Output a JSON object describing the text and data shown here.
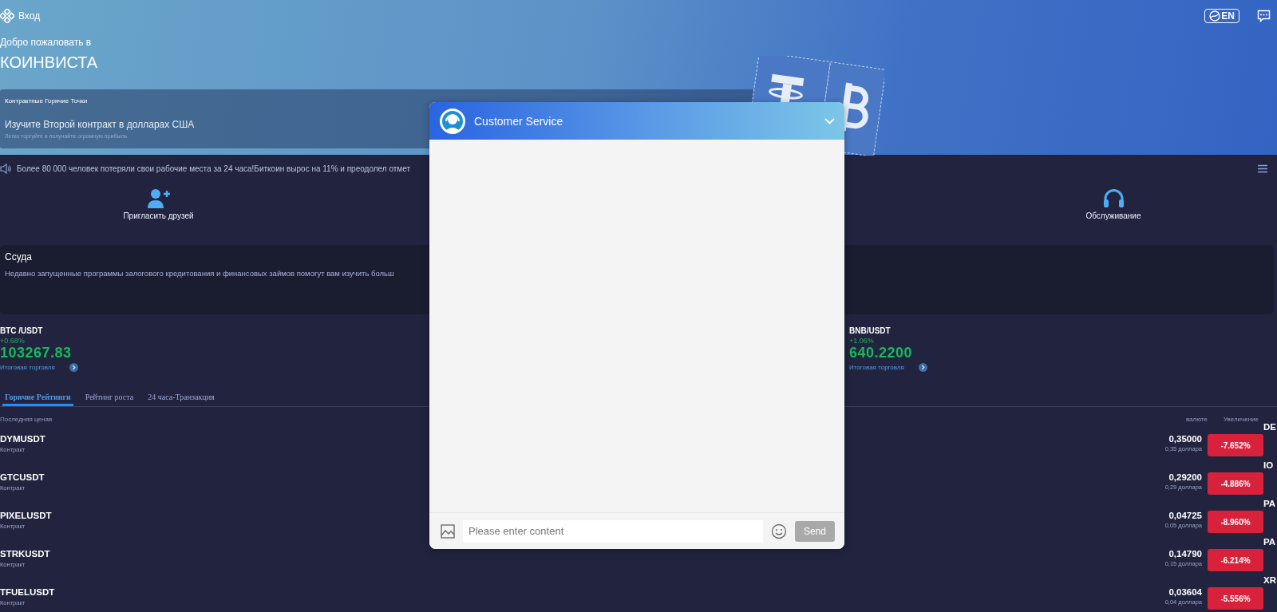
{
  "header": {
    "login": "Вход",
    "language": "EN",
    "welcome": "Добро пожаловать в",
    "brand": "КОИНВИСТА"
  },
  "banner": {
    "label": "Контрактные Горячие Точки",
    "title": "Изучите Второй контракт в долларах США",
    "subtitle": "Легко торгуйте и получайте огромную прибыль"
  },
  "ticker": {
    "text": "Более 80 000 человек потеряли свои рабочие места за 24 часа!Биткоин вырос на 11% и преодолел отмет"
  },
  "quick_actions": [
    {
      "kind": "invite",
      "label": "Пригласить друзей"
    },
    {
      "kind": "service",
      "label": "Обслуживание"
    }
  ],
  "loan": {
    "title": "Ссуда",
    "text": "Недавно запущенные программы залогового кредитования и финансовых займов помогут вам изучить больш"
  },
  "markets": [
    {
      "pair": "BTC /USDT",
      "change": "+0.68%",
      "price": "103267.83",
      "link": "Итоговая торговля"
    },
    {
      "pair": "BNB/USDT",
      "change": "+1.06%",
      "price": "640.2200",
      "link": "Итоговая торговля"
    }
  ],
  "tabs": [
    {
      "label": "Горячие Рейтинги",
      "selected": true
    },
    {
      "label": "Рейтинг роста",
      "selected": false
    },
    {
      "label": "24 часа-Транзакция",
      "selected": false
    }
  ],
  "table": {
    "columns": [
      "Последняя ценав",
      "валюте",
      "Увеличение"
    ],
    "rows": [
      {
        "symbol": "DYMUSDT",
        "type": "Контракт",
        "price": "0,35000",
        "usd": "0,35 доллара",
        "change": "-7.652%",
        "adjacent_symbol": "DE"
      },
      {
        "symbol": "GTCUSDT",
        "type": "Контракт",
        "price": "0,29200",
        "usd": "0,29 доллара",
        "change": "-4.886%",
        "adjacent_symbol": "IO"
      },
      {
        "symbol": "PIXELUSDT",
        "type": "Контракт",
        "price": "0,04725",
        "usd": "0,05 доллара",
        "change": "-8.960%",
        "adjacent_symbol": "PA"
      },
      {
        "symbol": "STRKUSDT",
        "type": "Контракт",
        "price": "0,14790",
        "usd": "0,15 доллара",
        "change": "-6.214%",
        "adjacent_symbol": "PA"
      },
      {
        "symbol": "TFUELUSDT",
        "type": "Контракт",
        "price": "0,03604",
        "usd": "0,04 доллара",
        "change": "-5.556%",
        "adjacent_symbol": "XR"
      }
    ]
  },
  "chat": {
    "title": "Customer Service",
    "placeholder": "Please enter content",
    "send": "Send",
    "send_disabled": true
  }
}
